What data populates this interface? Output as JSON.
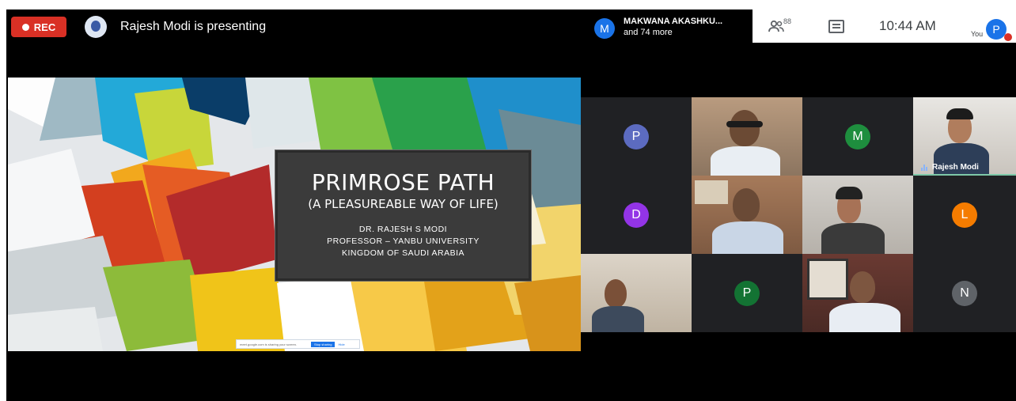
{
  "top_bar": {
    "rec_label": "REC",
    "presenting_text": "Rajesh Modi is presenting",
    "participant_avatar_letter": "M",
    "participant_name": "MAKWANA AKASHKU...",
    "participant_more": "and 74 more",
    "people_count": "88",
    "time": "10:44 AM",
    "you_label": "You",
    "self_avatar_letter": "P",
    "colors": {
      "rec": "#d93025",
      "accent": "#1a73e8"
    }
  },
  "slide": {
    "title": "PRIMROSE PATH",
    "subtitle": "(A PLEASUREABLE WAY OF LIFE)",
    "author_name": "DR. RAJESH S MODI",
    "author_role": "PROFESSOR – YANBU UNIVERSITY",
    "author_location": "KINGDOM OF SAUDI ARABIA",
    "share_bar": {
      "text": "meet.google.com is sharing your screen.",
      "stop_label": "Stop sharing",
      "hide_label": "Hide"
    }
  },
  "tiles": [
    {
      "type": "avatar",
      "letter": "P",
      "color": "#5c6bc0"
    },
    {
      "type": "video",
      "name": ""
    },
    {
      "type": "avatar",
      "letter": "M",
      "color": "#1e8e3e"
    },
    {
      "type": "video",
      "name": "Rajesh Modi"
    },
    {
      "type": "avatar",
      "letter": "D",
      "color": "#9334e6"
    },
    {
      "type": "video",
      "name": ""
    },
    {
      "type": "video",
      "name": ""
    },
    {
      "type": "avatar",
      "letter": "L",
      "color": "#f57c00"
    },
    {
      "type": "video",
      "name": ""
    },
    {
      "type": "avatar",
      "letter": "P",
      "color": "#137333"
    },
    {
      "type": "video",
      "name": ""
    },
    {
      "type": "avatar",
      "letter": "N",
      "color": "#5f6368"
    }
  ]
}
